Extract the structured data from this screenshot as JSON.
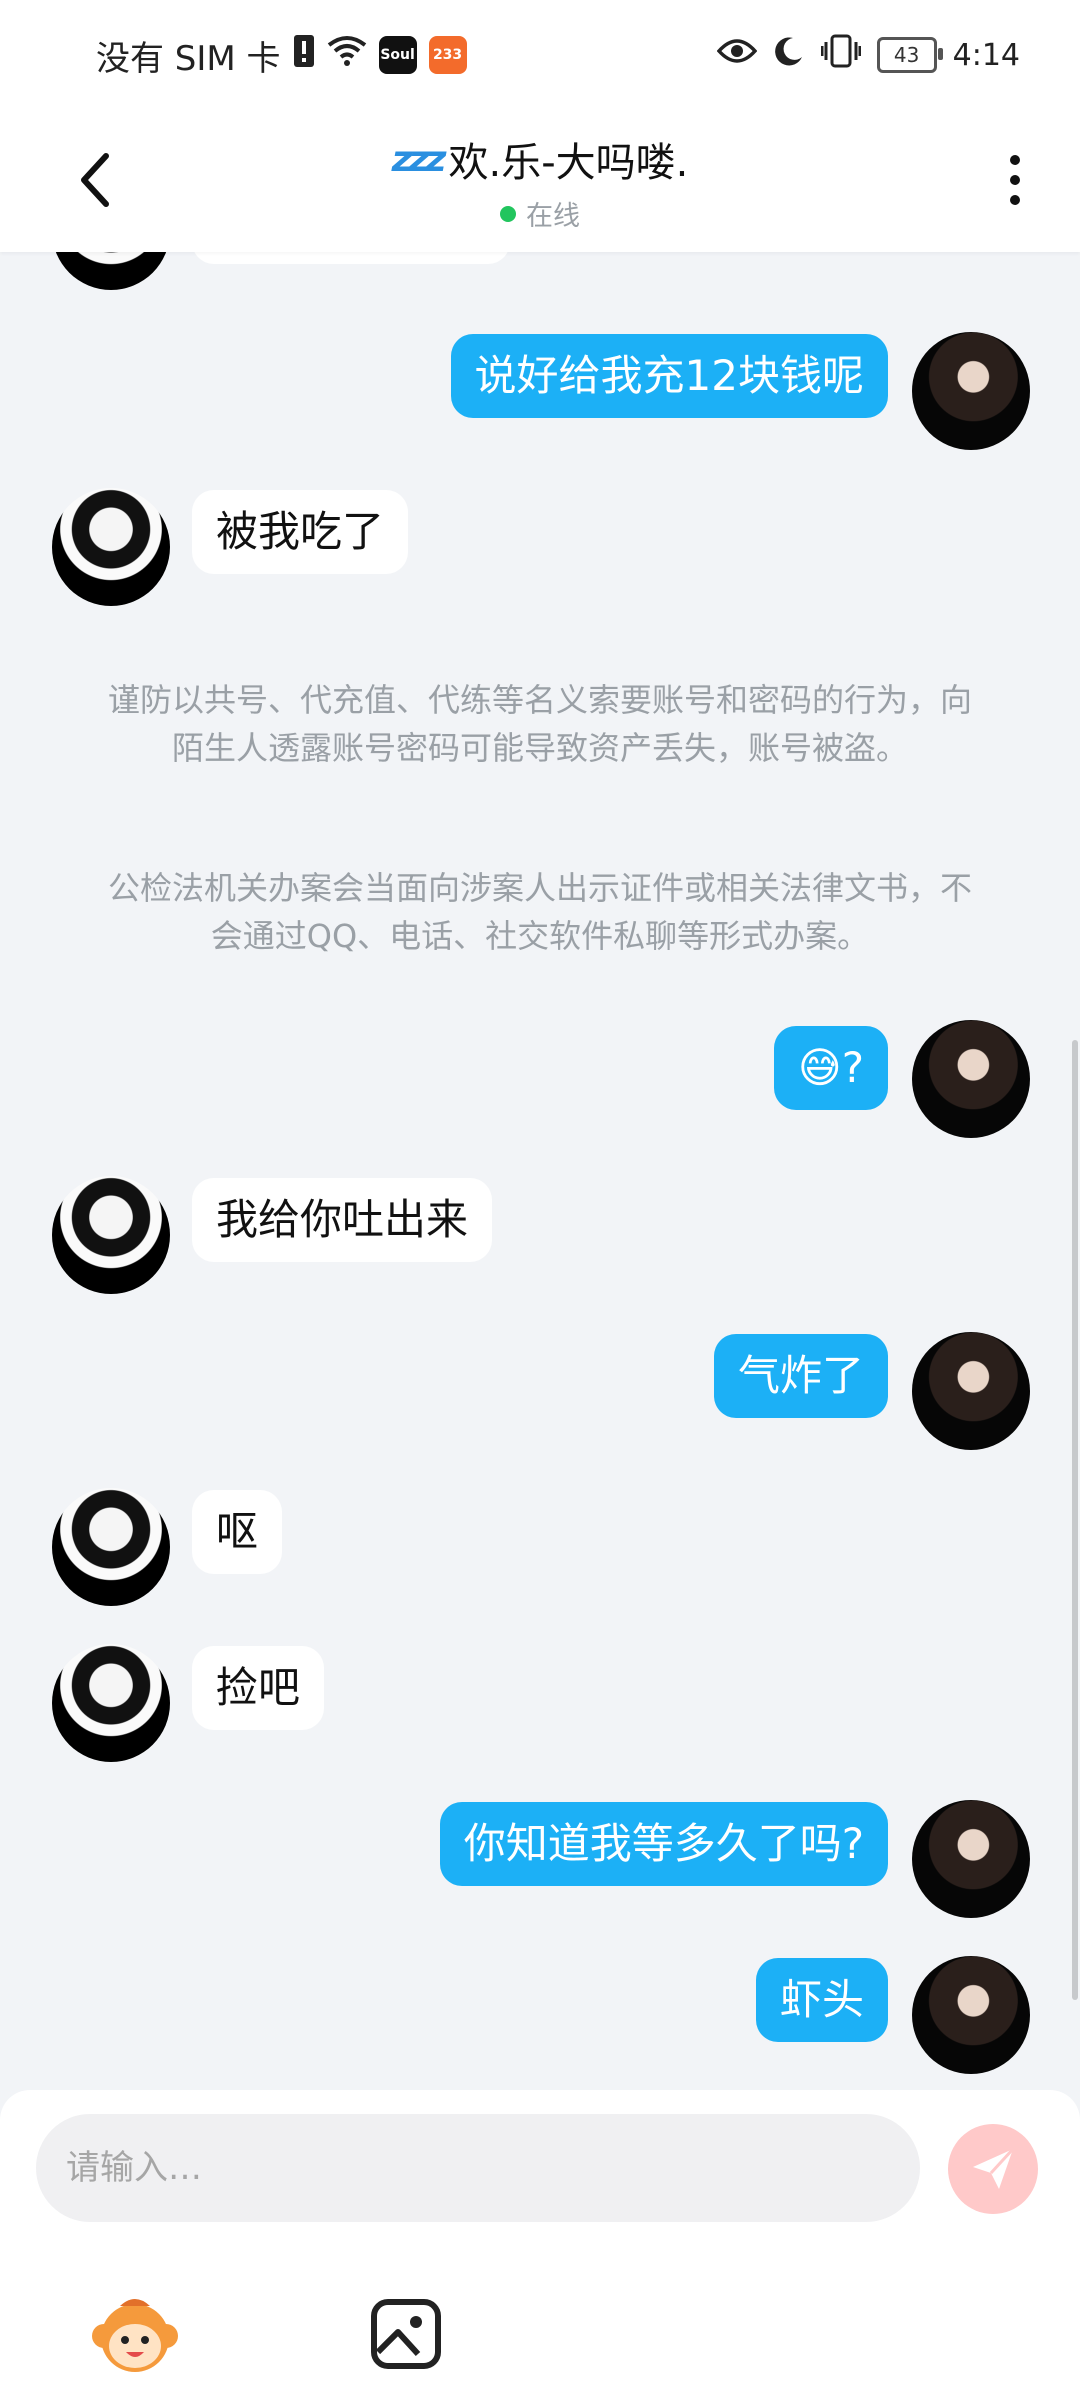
{
  "status_bar": {
    "carrier": "没有 SIM 卡",
    "app_soul": "Soul",
    "app_233": "233",
    "battery": "43",
    "time": "4:14"
  },
  "header": {
    "title_prefix": "zzz",
    "title": "欢.乐-大吗喽.",
    "status": "在线"
  },
  "messages": [
    {
      "side": "out",
      "text": "说好给我充12块钱呢"
    },
    {
      "side": "in",
      "text": "被我吃了"
    },
    {
      "side": "out",
      "text": "😅?"
    },
    {
      "side": "in",
      "text": "我给你吐出来"
    },
    {
      "side": "out",
      "text": "气炸了"
    },
    {
      "side": "in",
      "text": "呕"
    },
    {
      "side": "in",
      "text": "捡吧"
    },
    {
      "side": "out",
      "text": "你知道我等多久了吗?"
    },
    {
      "side": "out",
      "text": "虾头"
    }
  ],
  "system_notices": [
    "谨防以共号、代充值、代练等名义索要账号和密码的行为，向陌生人透露账号密码可能导致资产丢失，账号被盗。",
    "公检法机关办案会当面向涉案人出示证件或相关法律文书，不会通过QQ、电话、社交软件私聊等形式办案。"
  ],
  "input": {
    "placeholder": "请输入…"
  },
  "colors": {
    "bubble_out": "#1cb0f6",
    "bubble_in": "#ffffff",
    "send_button": "#ffc9c9",
    "online_dot": "#22c55e"
  },
  "icons": [
    "back-arrow-icon",
    "more-vertical-icon",
    "send-icon",
    "mascot-icon",
    "image-icon",
    "eye-icon",
    "moon-icon",
    "vibrate-icon",
    "wifi-icon"
  ]
}
